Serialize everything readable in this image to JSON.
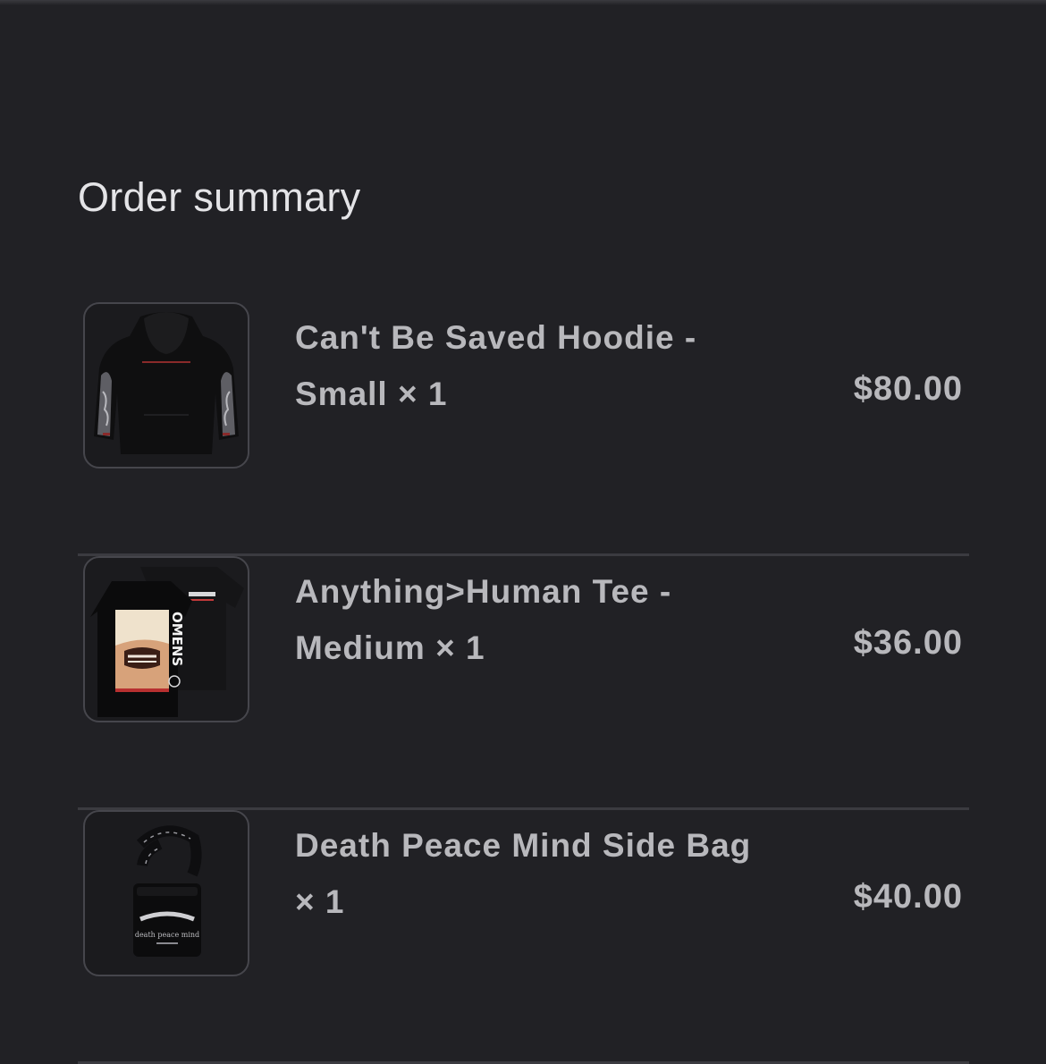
{
  "order_summary": {
    "title": "Order summary",
    "items": [
      {
        "name": "Can't Be Saved Hoodie - Small",
        "quantity": "× 1",
        "price": "$80.00",
        "image_icon": "hoodie-image"
      },
      {
        "name": "Anything>Human Tee - Medium",
        "quantity": "× 1",
        "price": "$36.00",
        "image_icon": "tee-image"
      },
      {
        "name": "Death Peace Mind Side Bag",
        "quantity": "× 1",
        "price": "$40.00",
        "image_icon": "side-bag-image"
      }
    ]
  },
  "colors": {
    "background": "#212125",
    "text": "#b8b8bc",
    "heading": "#e4e4e7",
    "divider": "#3b3b40"
  },
  "product_print_text": {
    "tee_brand": "OMENS",
    "bag_print": "death peace mind"
  }
}
